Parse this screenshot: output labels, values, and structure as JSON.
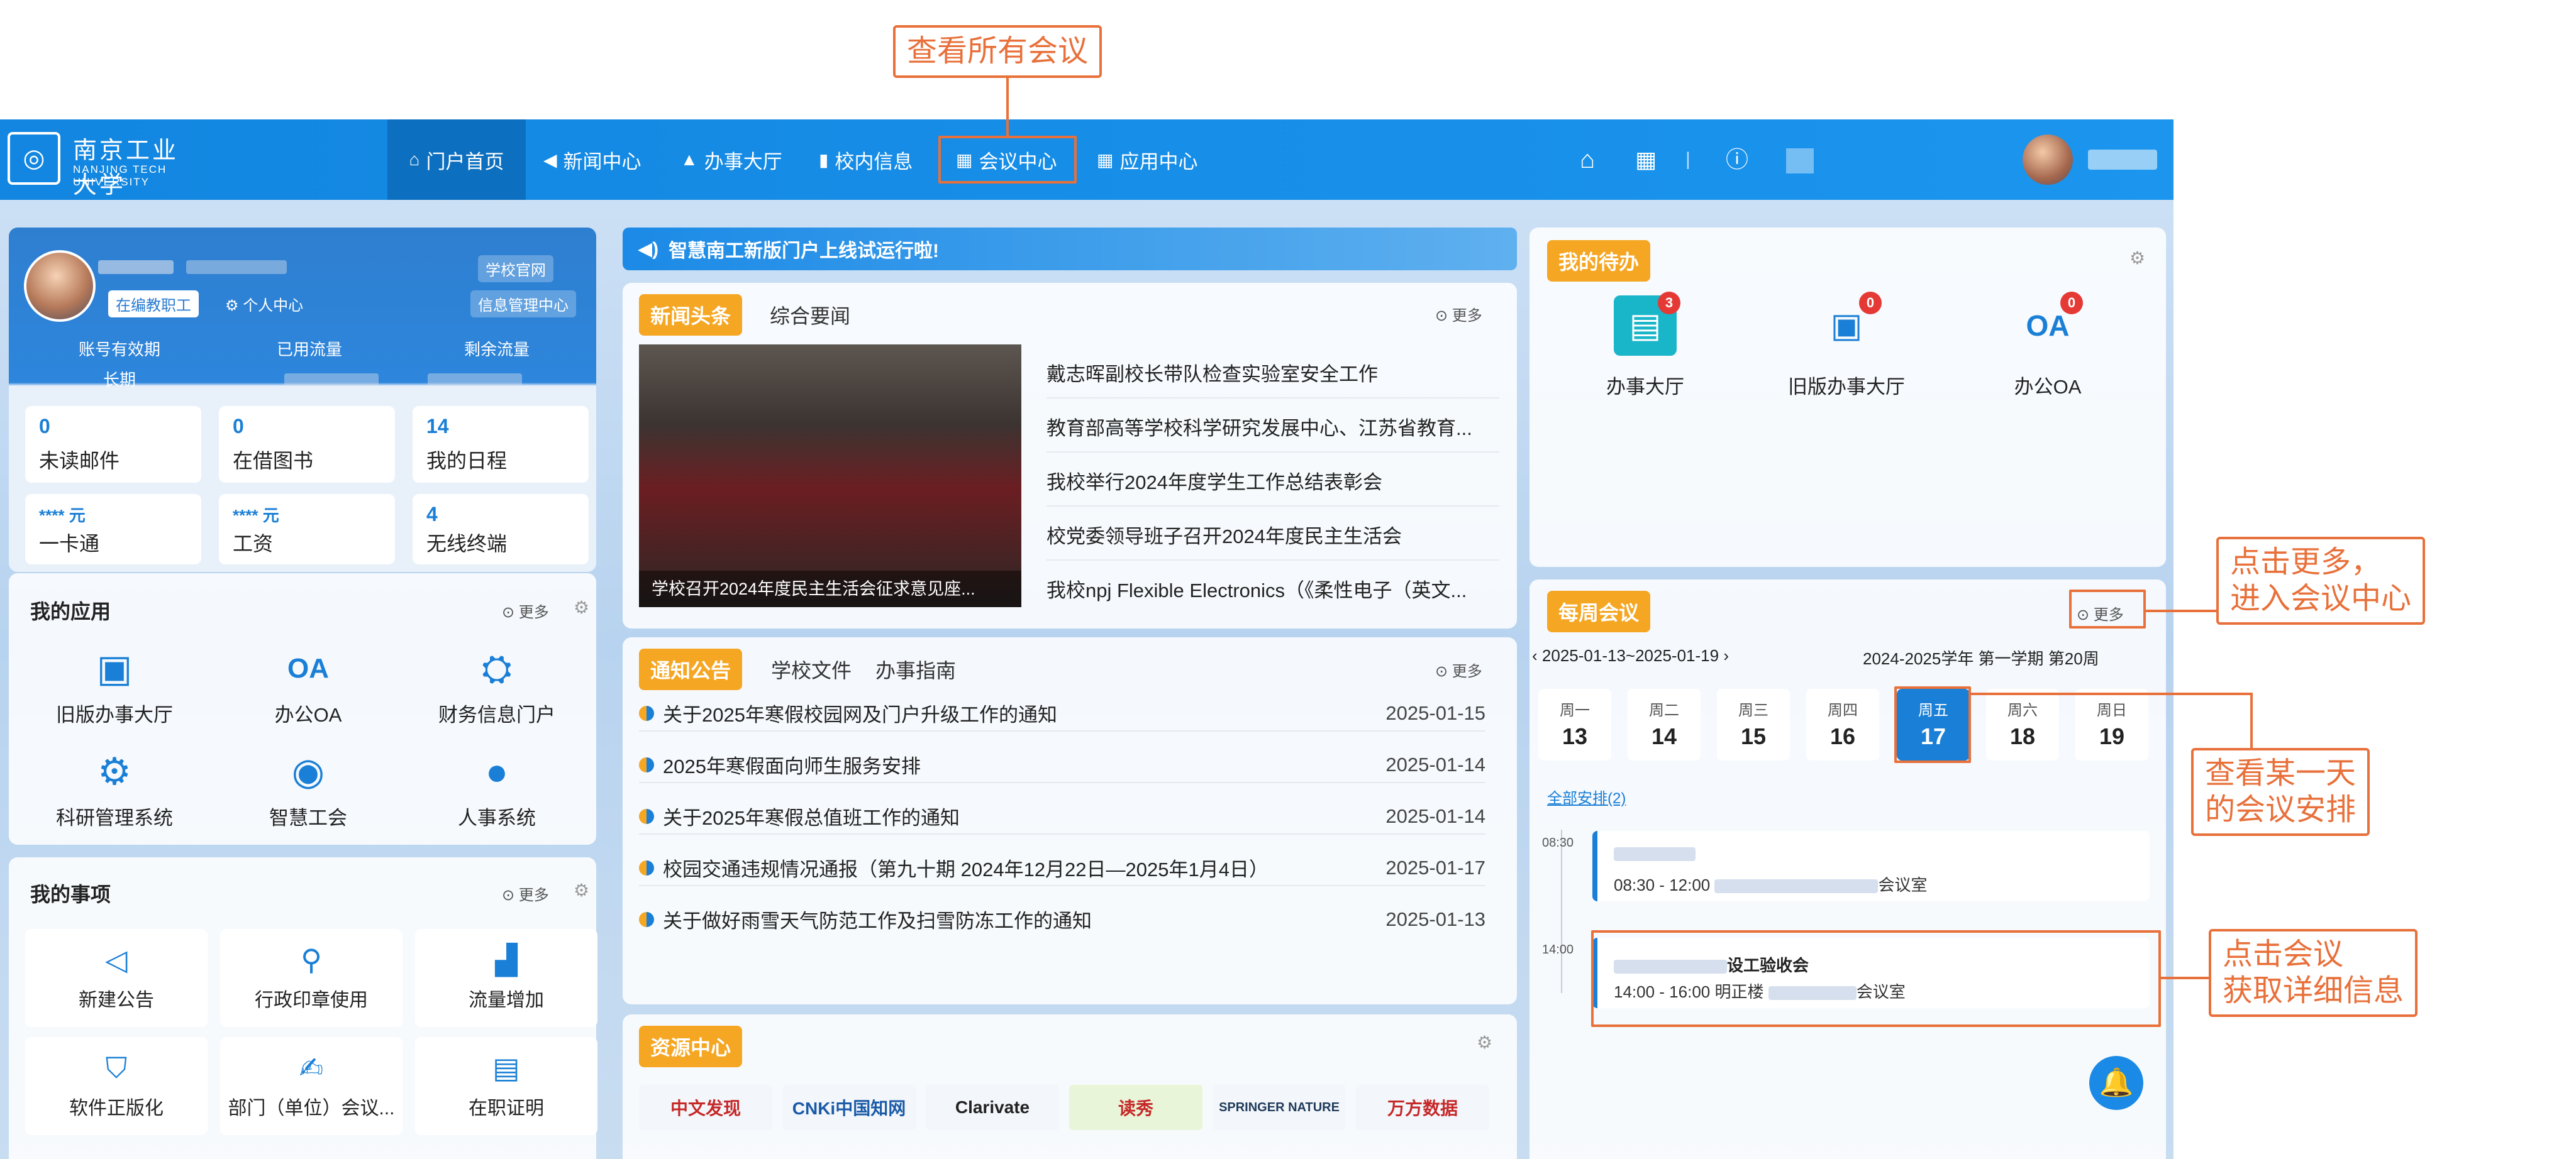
{
  "nav": {
    "logo_cn": "南京工业大学",
    "logo_en_1": "NANJING TECH",
    "logo_en_2": "UNIVERSITY",
    "items": [
      {
        "icon": "⌂",
        "label": "门户首页"
      },
      {
        "icon": "◀",
        "label": "新闻中心"
      },
      {
        "icon": "▲",
        "label": "办事大厅"
      },
      {
        "icon": "▮",
        "label": "校内信息"
      },
      {
        "icon": "▦",
        "label": "会议中心"
      },
      {
        "icon": "▦",
        "label": "应用中心"
      }
    ],
    "tool_icons": [
      "home-icon",
      "grid-icon",
      "help-icon"
    ]
  },
  "profile": {
    "tag": "在编教职工",
    "personal_center": "个人中心",
    "school_site": "学校官网",
    "info_portal": "信息管理中心",
    "stats_labels": [
      "账号有效期",
      "已用流量",
      "剩余流量"
    ],
    "account_valid": "长期",
    "boxes": [
      {
        "num": "0",
        "label": "未读邮件"
      },
      {
        "num": "0",
        "label": "在借图书"
      },
      {
        "num": "14",
        "label": "我的日程"
      },
      {
        "num": "**** 元",
        "label": "一卡通"
      },
      {
        "num": "**** 元",
        "label": "工资"
      },
      {
        "num": "4",
        "label": "无线终端"
      }
    ]
  },
  "my_apps": {
    "title": "我的应用",
    "more": "更多",
    "items": [
      "旧版办事大厅",
      "办公OA",
      "财务信息门户",
      "科研管理系统",
      "智慧工会",
      "人事系统"
    ]
  },
  "my_matters": {
    "title": "我的事项",
    "more": "更多",
    "items": [
      "新建公告",
      "行政印章使用",
      "流量增加",
      "软件正版化",
      "部门（单位）会议...",
      "在职证明"
    ]
  },
  "banner": {
    "text": "智慧南工新版门户上线试运行啦!"
  },
  "news": {
    "tab_active": "新闻头条",
    "tab_other": "综合要闻",
    "more": "更多",
    "photo_caption": "学校召开2024年度民主生活会征求意见座...",
    "items": [
      "戴志晖副校长带队检查实验室安全工作",
      "教育部高等学校科学研究发展中心、江苏省教育...",
      "我校举行2024年度学生工作总结表彰会",
      "校党委领导班子召开2024年度民主生活会",
      "我校npj Flexible Electronics（《柔性电子（英文..."
    ]
  },
  "notices": {
    "tab_active": "通知公告",
    "tabs": [
      "学校文件",
      "办事指南"
    ],
    "more": "更多",
    "items": [
      {
        "title": "关于2025年寒假校园网及门户升级工作的通知",
        "date": "2025-01-15"
      },
      {
        "title": "2025年寒假面向师生服务安排",
        "date": "2025-01-14"
      },
      {
        "title": "关于2025年寒假总值班工作的通知",
        "date": "2025-01-14"
      },
      {
        "title": "校园交通违规情况通报（第九十期 2024年12月22日—2025年1月4日）",
        "date": "2025-01-17"
      },
      {
        "title": "关于做好雨雪天气防范工作及扫雪防冻工作的通知",
        "date": "2025-01-13"
      }
    ]
  },
  "resources": {
    "title": "资源中心",
    "logos": [
      "中文发现",
      "CNKi中国知网",
      "Clarivate",
      "读秀",
      "SPRINGER NATURE",
      "万方数据"
    ]
  },
  "todo": {
    "title": "我的待办",
    "items": [
      {
        "label": "办事大厅",
        "badge": "3"
      },
      {
        "label": "旧版办事大厅",
        "badge": "0"
      },
      {
        "label": "办公OA",
        "badge": "0"
      }
    ]
  },
  "meetings": {
    "title": "每周会议",
    "more": "更多",
    "range": "2025-01-13~2025-01-19",
    "term": "2024-2025学年 第一学期 第20周",
    "days": [
      {
        "w": "周一",
        "n": "13"
      },
      {
        "w": "周二",
        "n": "14"
      },
      {
        "w": "周三",
        "n": "15"
      },
      {
        "w": "周四",
        "n": "16"
      },
      {
        "w": "周五",
        "n": "17"
      },
      {
        "w": "周六",
        "n": "18"
      },
      {
        "w": "周日",
        "n": "19"
      }
    ],
    "selected_day": "17",
    "all_label": "全部安排(2)",
    "items": [
      {
        "time_label": "08:30",
        "title": "",
        "time": "08:30 - 12:00",
        "place": "会议室"
      },
      {
        "time_label": "14:00",
        "title": "设工验收会",
        "time": "14:00 - 16:00",
        "place_prefix": "明正楼",
        "place": "会议室"
      }
    ]
  },
  "callouts": {
    "all_meetings": "查看所有会议",
    "more_1": "点击更多，",
    "more_2": "进入会议中心",
    "day_1": "查看某一天",
    "day_2": "的会议安排",
    "detail_1": "点击会议",
    "detail_2": "获取详细信息"
  },
  "colors": {
    "brand": "#1286e0",
    "accent": "#f5a623",
    "annotation": "#e8703a"
  }
}
